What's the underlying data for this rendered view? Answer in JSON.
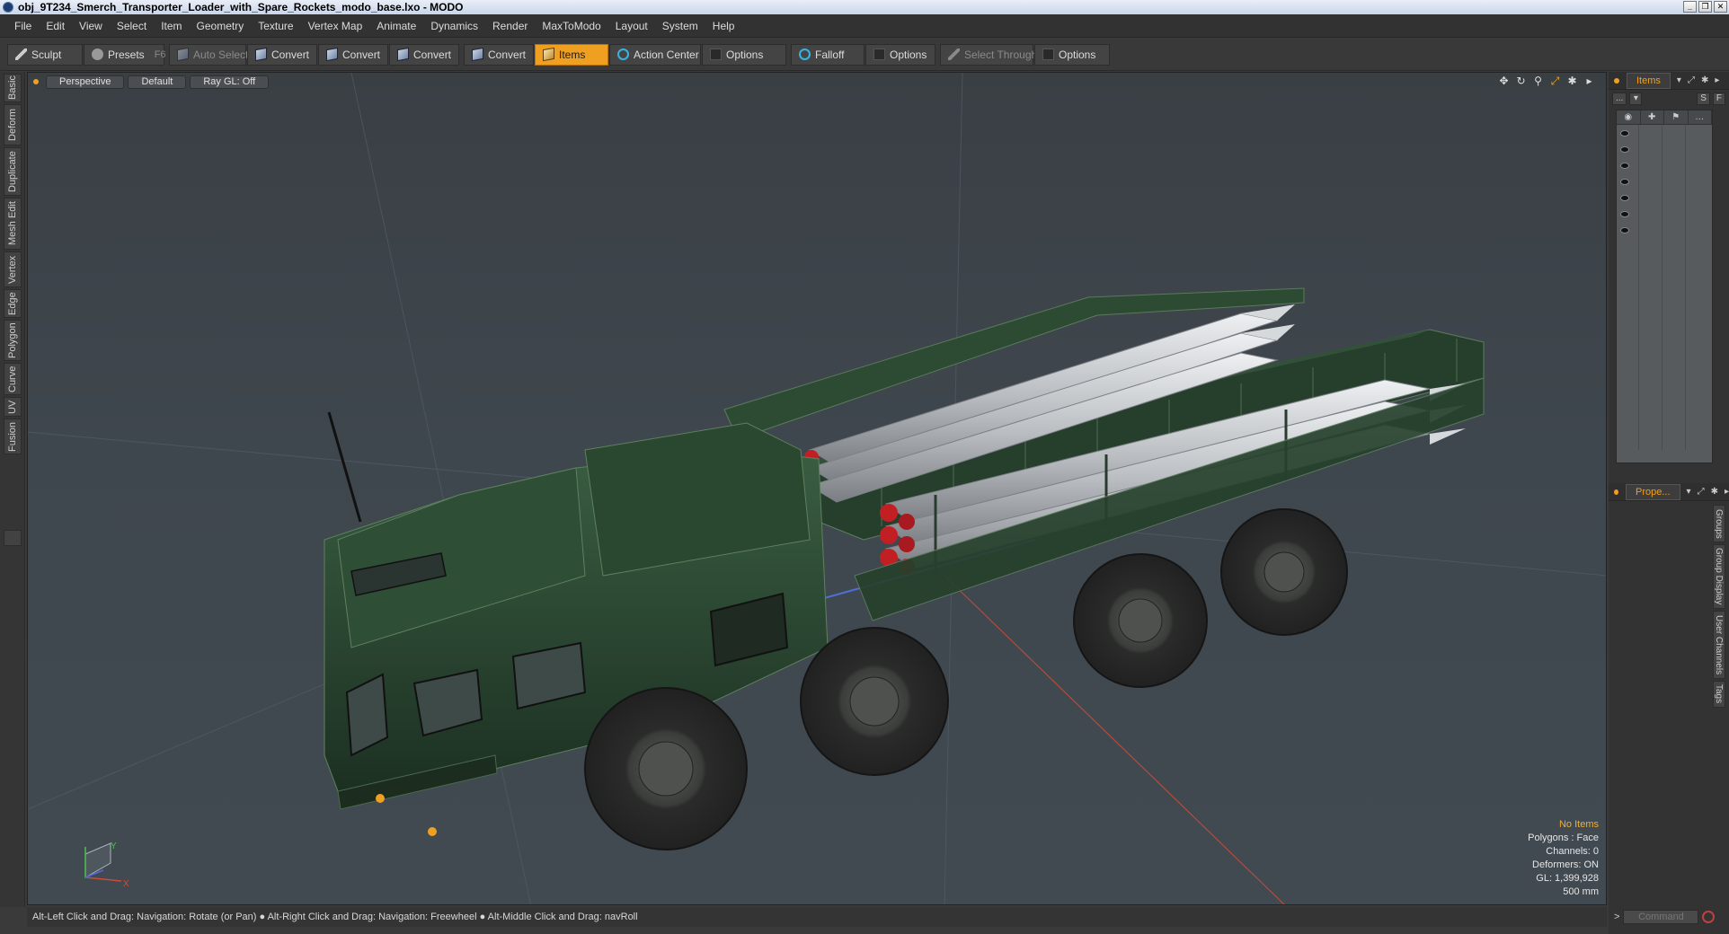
{
  "window": {
    "title": "obj_9T234_Smerch_Transporter_Loader_with_Spare_Rockets_modo_base.lxo - MODO",
    "buttons": [
      "_",
      "❐",
      "✕"
    ]
  },
  "menubar": [
    "File",
    "Edit",
    "View",
    "Select",
    "Item",
    "Geometry",
    "Texture",
    "Vertex Map",
    "Animate",
    "Dynamics",
    "Render",
    "MaxToModo",
    "Layout",
    "System",
    "Help"
  ],
  "toolbar": {
    "sculpt": "Sculpt",
    "presets": "Presets",
    "presets_key": "F6",
    "auto_select": "Auto Select",
    "convert1": "Convert",
    "convert2": "Convert",
    "convert3": "Convert",
    "convert4": "Convert",
    "items": "Items",
    "action_center": "Action Center",
    "options1": "Options",
    "falloff": "Falloff",
    "options2": "Options",
    "select_through": "Select Through",
    "options3": "Options"
  },
  "left_tabs": [
    "Basic",
    "Deform",
    "Duplicate",
    "Mesh Edit",
    "Vertex",
    "Edge",
    "Polygon",
    "Curve",
    "UV",
    "Fusion"
  ],
  "viewport": {
    "view_mode": "Perspective",
    "shading": "Default",
    "raygl": "Ray GL: Off",
    "nav_icons": [
      "move-icon",
      "rotate-icon",
      "zoom-icon",
      "fit-icon",
      "settings-icon",
      "more-icon"
    ],
    "axis_labels": {
      "y": "Y",
      "x": "X"
    },
    "hud": {
      "selection": "No Items",
      "polygons": "Polygons : Face",
      "channels": "Channels: 0",
      "deformers": "Deformers: ON",
      "gl": "GL: 1,399,928",
      "grid": "500 mm"
    }
  },
  "statusbar": "Alt-Left Click and Drag: Navigation: Rotate (or Pan) ● Alt-Right Click and Drag: Navigation: Freewheel ● Alt-Middle Click and Drag: navRoll",
  "items_panel": {
    "tab": "Items",
    "sub_buttons": [
      "...",
      "▾",
      "S",
      "F"
    ],
    "row_count": 7
  },
  "properties_panel": {
    "tab": "Prope...",
    "side_tabs": [
      "Groups",
      "Group Display",
      "User Channels",
      "Tags"
    ]
  },
  "command": {
    "placeholder": "Command",
    "prompt": ">"
  },
  "colors": {
    "accent": "#f0a020",
    "truck": "#2b4a33",
    "rocket": "#c8ccd0",
    "rocket_tip": "#c21f24"
  }
}
